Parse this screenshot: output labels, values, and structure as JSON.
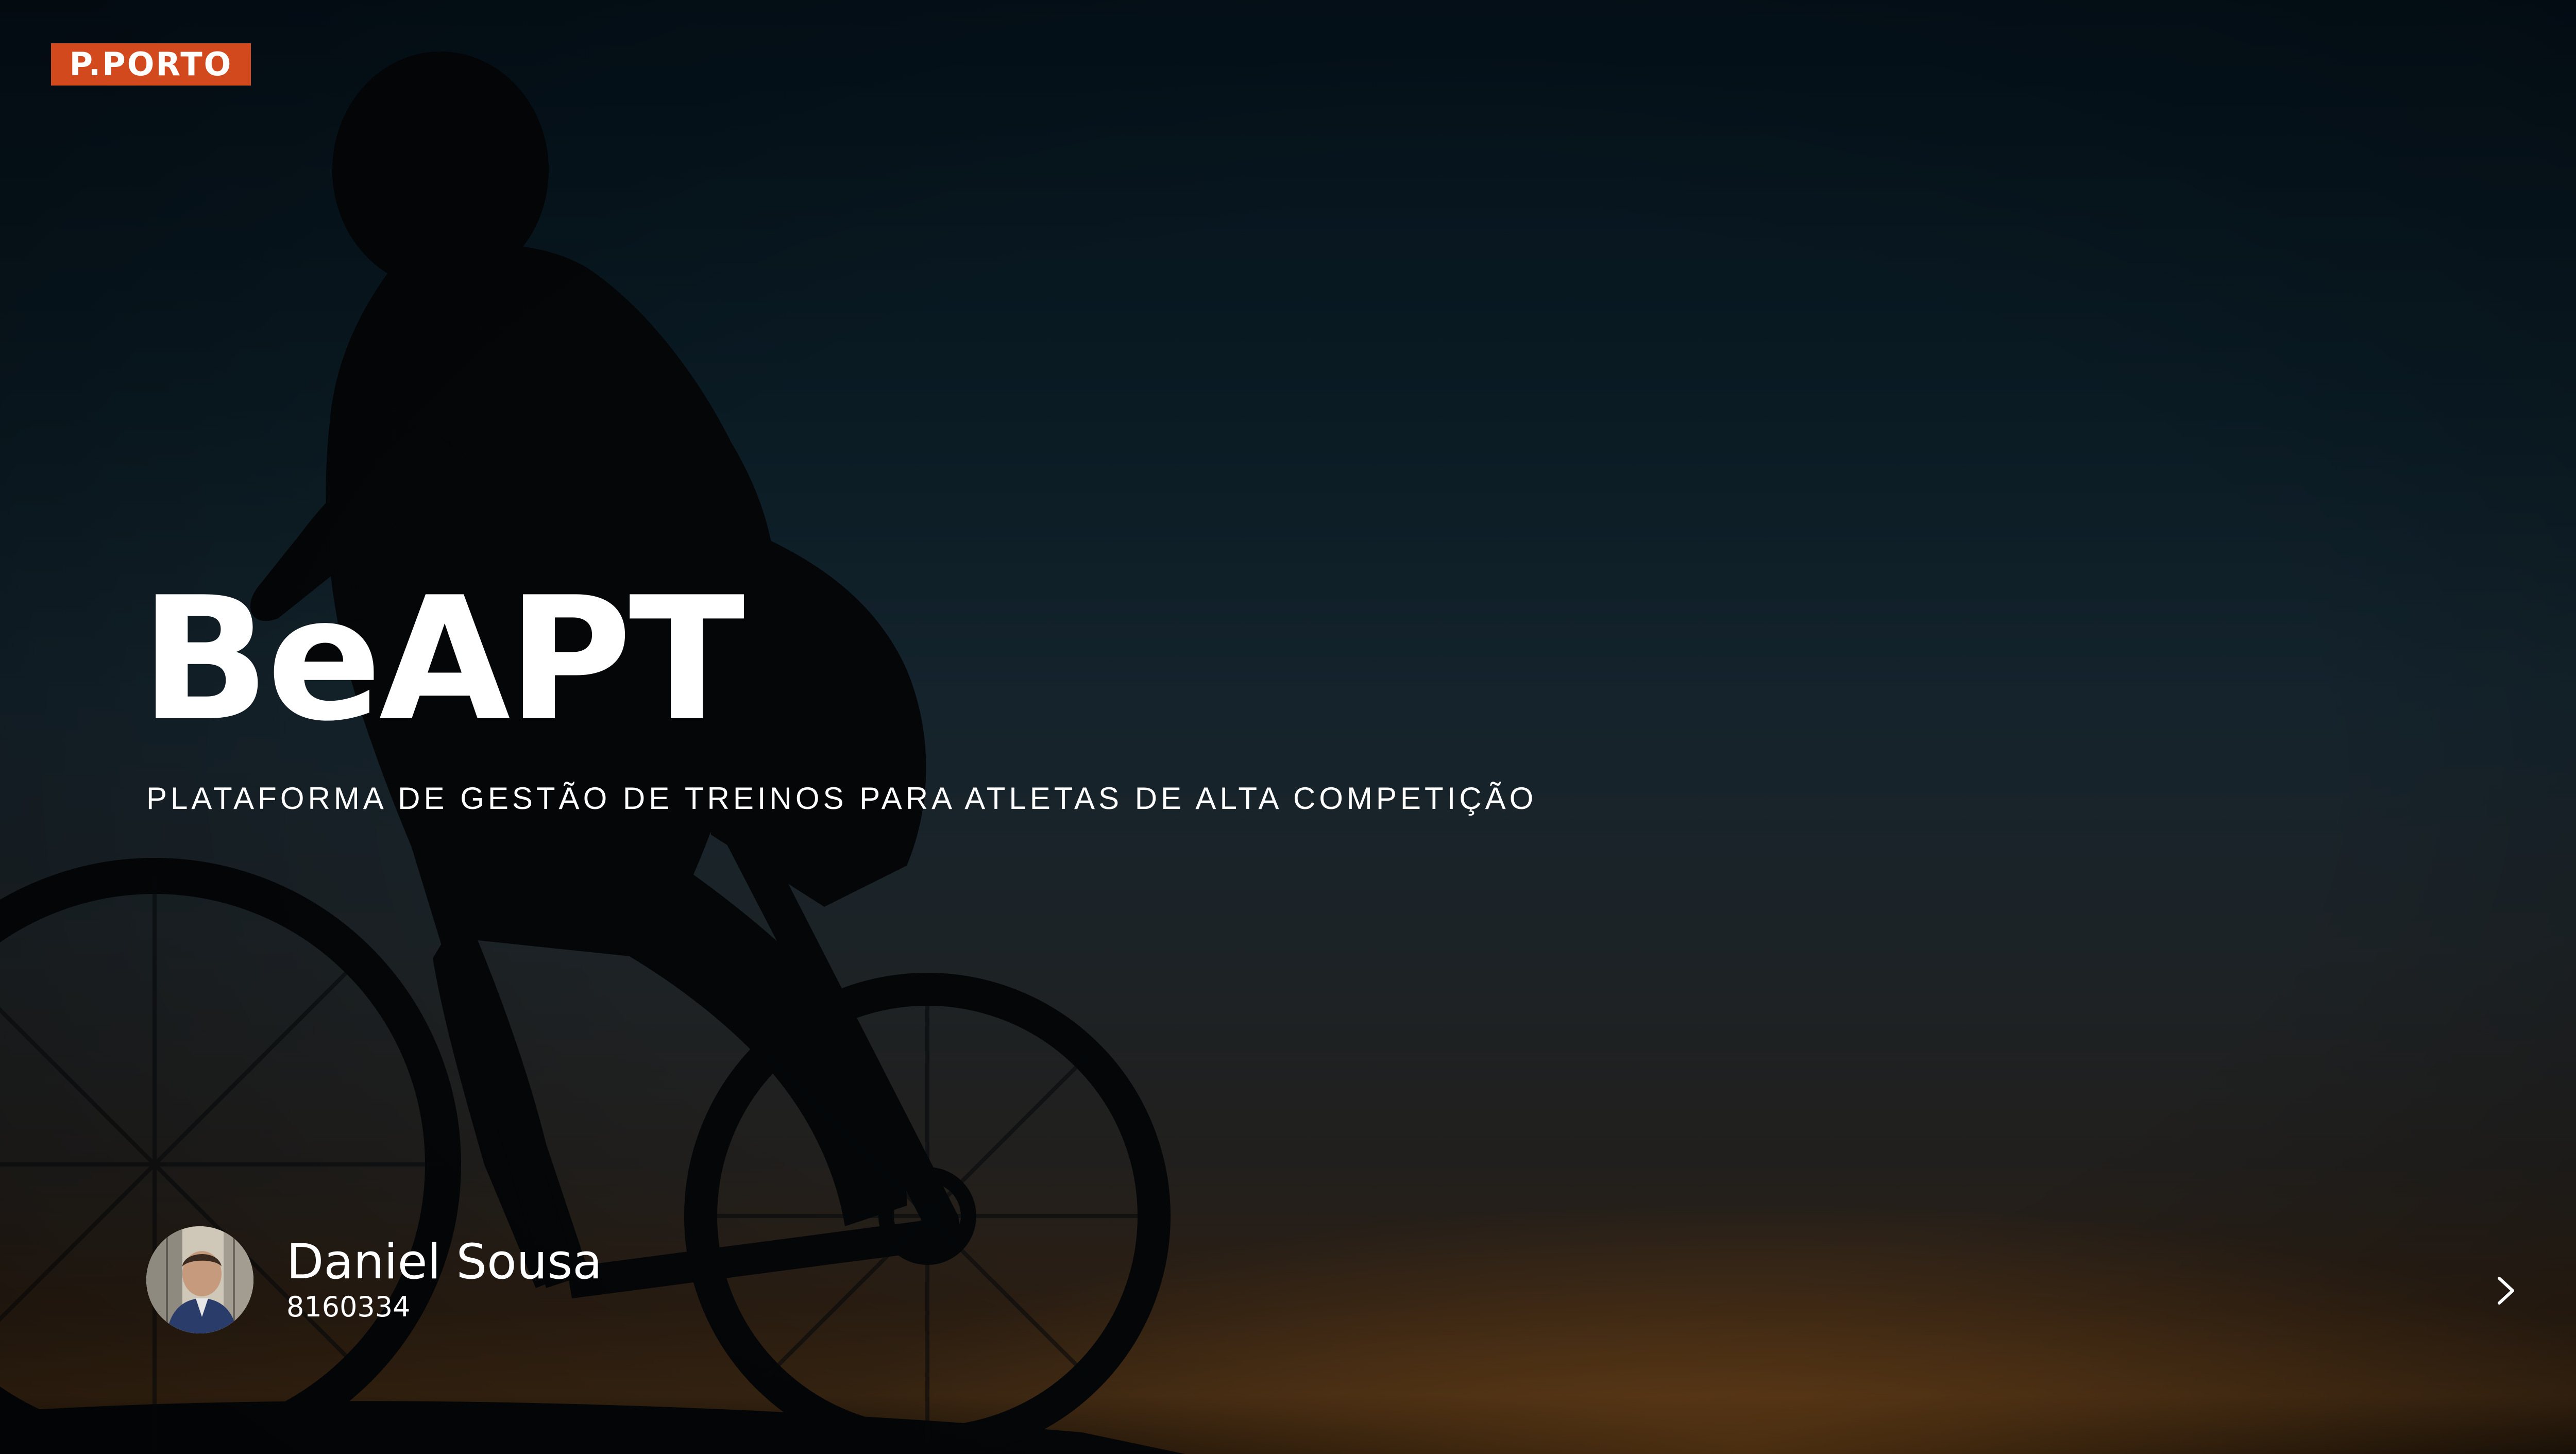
{
  "brand": {
    "logo_text": "P.PORTO",
    "logo_color": "#d2491d"
  },
  "hero": {
    "title": "BeAPT",
    "subtitle": "PLATAFORMA DE GESTÃO DE TREINOS PARA ATLETAS DE ALTA COMPETIÇÃO"
  },
  "author": {
    "name": "Daniel Sousa",
    "student_number": "8160334"
  },
  "navigation": {
    "next_icon": "chevron-right-icon"
  },
  "colors": {
    "text": "#ffffff",
    "sky_top": "#04111a",
    "horizon": "#3a2612"
  }
}
